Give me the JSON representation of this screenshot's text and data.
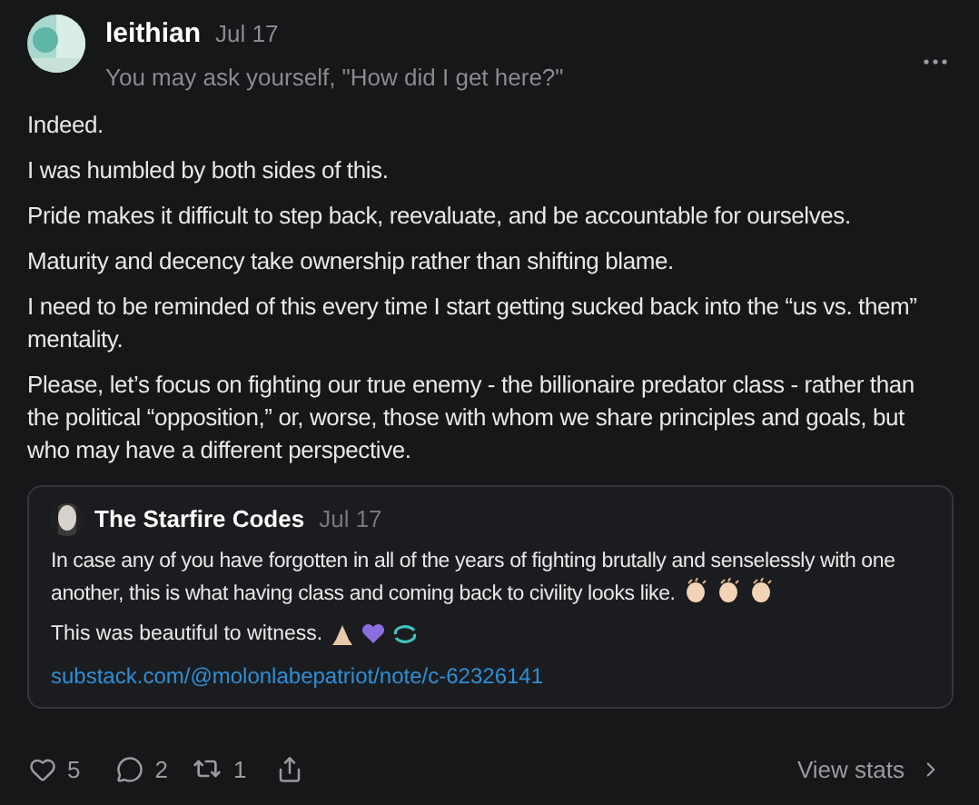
{
  "author": {
    "name": "leithian",
    "date": "Jul 17",
    "subtitle": "You may ask yourself, \"How did I get here?\""
  },
  "paragraphs": [
    "Indeed.",
    "I was humbled by both sides of this.",
    "Pride makes it difficult to step back, reevaluate, and be accountable for ourselves.",
    "Maturity and decency take ownership rather than shifting blame.",
    "I need to be reminded of this every time I start getting sucked back into the “us vs. them” mentality.",
    "Please, let’s focus on fighting our true enemy - the billionaire predator class - rather than the political “opposition,” or, worse, those with whom we share principles and goals, but who may have a different perspective."
  ],
  "quote": {
    "name": "The Starfire Codes",
    "date": "Jul 17",
    "paragraphs": [
      "In case any of you have forgotten in all of the years of fighting brutally and senselessly with one another, this is what having class and coming back to civility looks like.",
      "This was beautiful to witness."
    ],
    "link": "substack.com/@molonlabepatriot/note/c-62326141"
  },
  "actions": {
    "likes": "5",
    "comments": "2",
    "restacks": "1",
    "view_stats": "View stats"
  }
}
